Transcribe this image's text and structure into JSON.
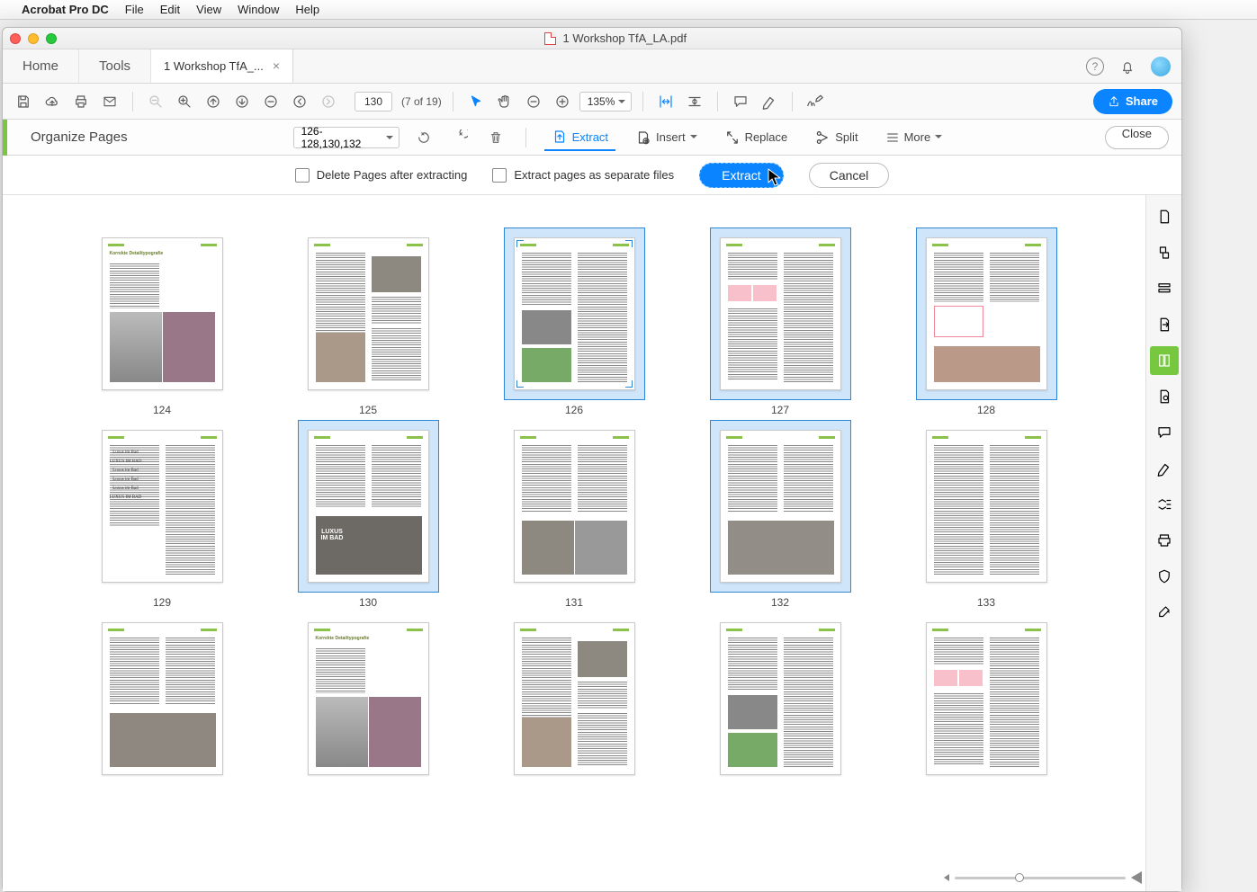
{
  "menubar": {
    "app": "Acrobat Pro DC",
    "items": [
      "File",
      "Edit",
      "View",
      "Window",
      "Help"
    ]
  },
  "window_title": "1  Workshop TfA_LA.pdf",
  "tabs": {
    "home": "Home",
    "tools": "Tools",
    "doc": "1  Workshop TfA_..."
  },
  "toolbar": {
    "page_current": "130",
    "page_total": "(7 of 19)",
    "zoom": "135%",
    "share": "Share"
  },
  "organize": {
    "title": "Organize Pages",
    "range": "126-128,130,132",
    "extract": "Extract",
    "insert": "Insert",
    "replace": "Replace",
    "split": "Split",
    "more": "More",
    "close": "Close"
  },
  "extractbar": {
    "delete_after": "Delete Pages after extracting",
    "separate": "Extract pages as separate files",
    "extract_btn": "Extract",
    "cancel_btn": "Cancel",
    "tooltip": "Extract"
  },
  "pages": [
    {
      "n": "124",
      "sel": false
    },
    {
      "n": "125",
      "sel": false
    },
    {
      "n": "126",
      "sel": true,
      "focus": true
    },
    {
      "n": "127",
      "sel": true
    },
    {
      "n": "128",
      "sel": true
    },
    {
      "n": "129",
      "sel": false
    },
    {
      "n": "130",
      "sel": true
    },
    {
      "n": "131",
      "sel": false
    },
    {
      "n": "132",
      "sel": true
    },
    {
      "n": "133",
      "sel": false
    },
    {
      "n": "",
      "sel": false
    },
    {
      "n": "",
      "sel": false
    },
    {
      "n": "",
      "sel": false
    },
    {
      "n": "",
      "sel": false
    },
    {
      "n": "",
      "sel": false
    }
  ]
}
